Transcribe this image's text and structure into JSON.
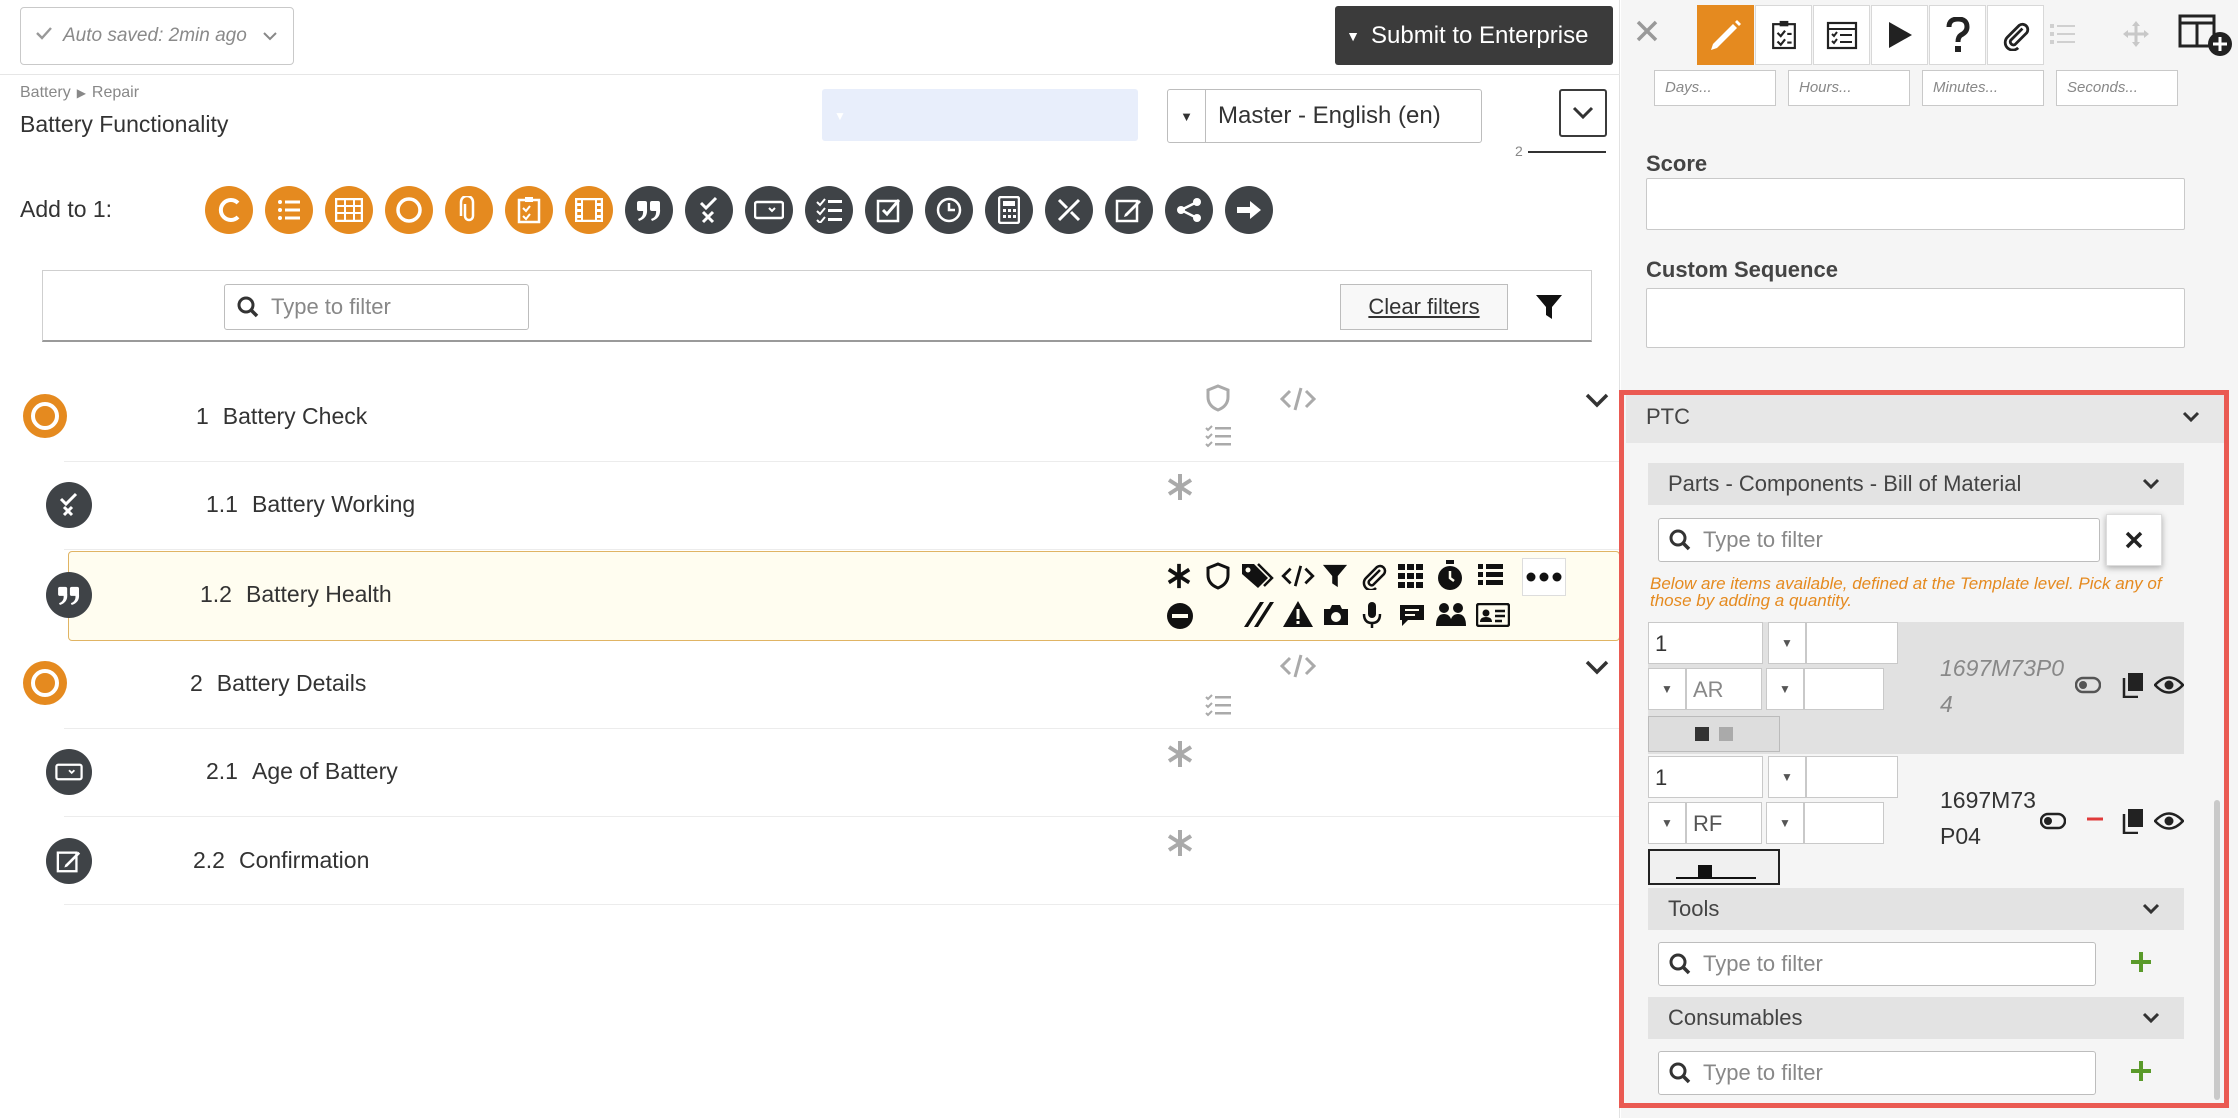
{
  "header": {
    "autosave": "Auto saved: 2min ago",
    "submit": "Submit to Enterprise"
  },
  "breadcrumb": {
    "root": "Battery",
    "current": "Repair"
  },
  "page_title": "Battery Functionality",
  "language": "Master - English (en)",
  "page_number": "2",
  "add_to_label": "Add to 1:",
  "filter": {
    "placeholder": "Type to filter",
    "clear": "Clear filters"
  },
  "rows": [
    {
      "num": "1",
      "label": "Battery Check"
    },
    {
      "num": "1.1",
      "label": "Battery Working"
    },
    {
      "num": "1.2",
      "label": "Battery Health"
    },
    {
      "num": "2",
      "label": "Battery Details"
    },
    {
      "num": "2.1",
      "label": "Age of Battery"
    },
    {
      "num": "2.2",
      "label": "Confirmation"
    }
  ],
  "side": {
    "time_inputs": [
      "Days...",
      "Hours...",
      "Minutes...",
      "Seconds..."
    ],
    "score_label": "Score",
    "custom_sequence_label": "Custom Sequence",
    "ptc_label": "PTC",
    "bom_label": "Parts - Components - Bill of Material",
    "filter_placeholder": "Type to filter",
    "note": "Below are items available, defined at the Template level. Pick any of those by adding a quantity.",
    "parts": [
      {
        "qty": "1",
        "unit": "AR",
        "code": "1697M73P0 4"
      },
      {
        "qty": "1",
        "unit": "RF",
        "code": "1697M73 P04"
      }
    ],
    "tools_label": "Tools",
    "consumables_label": "Consumables"
  },
  "colors": {
    "accent": "#e58a1f",
    "dark": "#3f4347",
    "highlight_box": "#ea5a52",
    "add_green": "#5a9a2a"
  }
}
